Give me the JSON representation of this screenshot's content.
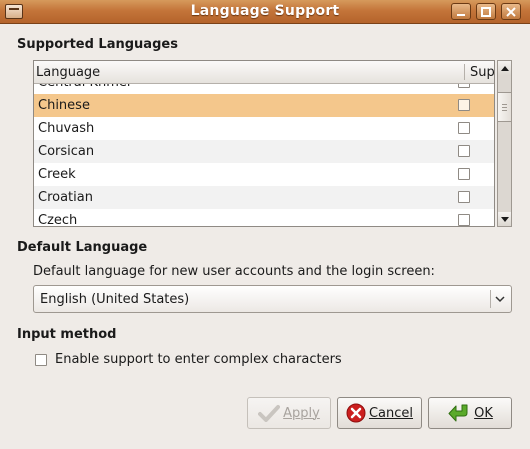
{
  "window": {
    "title": "Language Support"
  },
  "supported_languages": {
    "heading": "Supported Languages",
    "columns": [
      "Language",
      "Support"
    ],
    "rows": [
      {
        "name": "Central Khmer",
        "supported": false,
        "selected": false
      },
      {
        "name": "Chinese",
        "supported": false,
        "selected": true
      },
      {
        "name": "Chuvash",
        "supported": false,
        "selected": false
      },
      {
        "name": "Corsican",
        "supported": false,
        "selected": false
      },
      {
        "name": "Creek",
        "supported": false,
        "selected": false
      },
      {
        "name": "Croatian",
        "supported": false,
        "selected": false
      },
      {
        "name": "Czech",
        "supported": false,
        "selected": false
      }
    ]
  },
  "default_language": {
    "heading": "Default Language",
    "description": "Default language for new user accounts and the login screen:",
    "selected": "English (United States)"
  },
  "input_method": {
    "heading": "Input method",
    "checkbox_label": "Enable support to enter complex characters",
    "checked": false
  },
  "buttons": {
    "apply": "Apply",
    "cancel": "Cancel",
    "ok": "OK"
  },
  "colors": {
    "titlebar": "#c4753a",
    "selection": "#f4c78c",
    "window_bg": "#efebe7"
  },
  "icons": {
    "window_menu": "window-menu-icon",
    "minimize": "minimize-icon",
    "maximize": "maximize-icon",
    "close": "close-icon",
    "apply": "checkmark-icon",
    "cancel": "cancel-icon",
    "ok": "ok-arrow-icon",
    "combo": "chevron-down-icon"
  }
}
